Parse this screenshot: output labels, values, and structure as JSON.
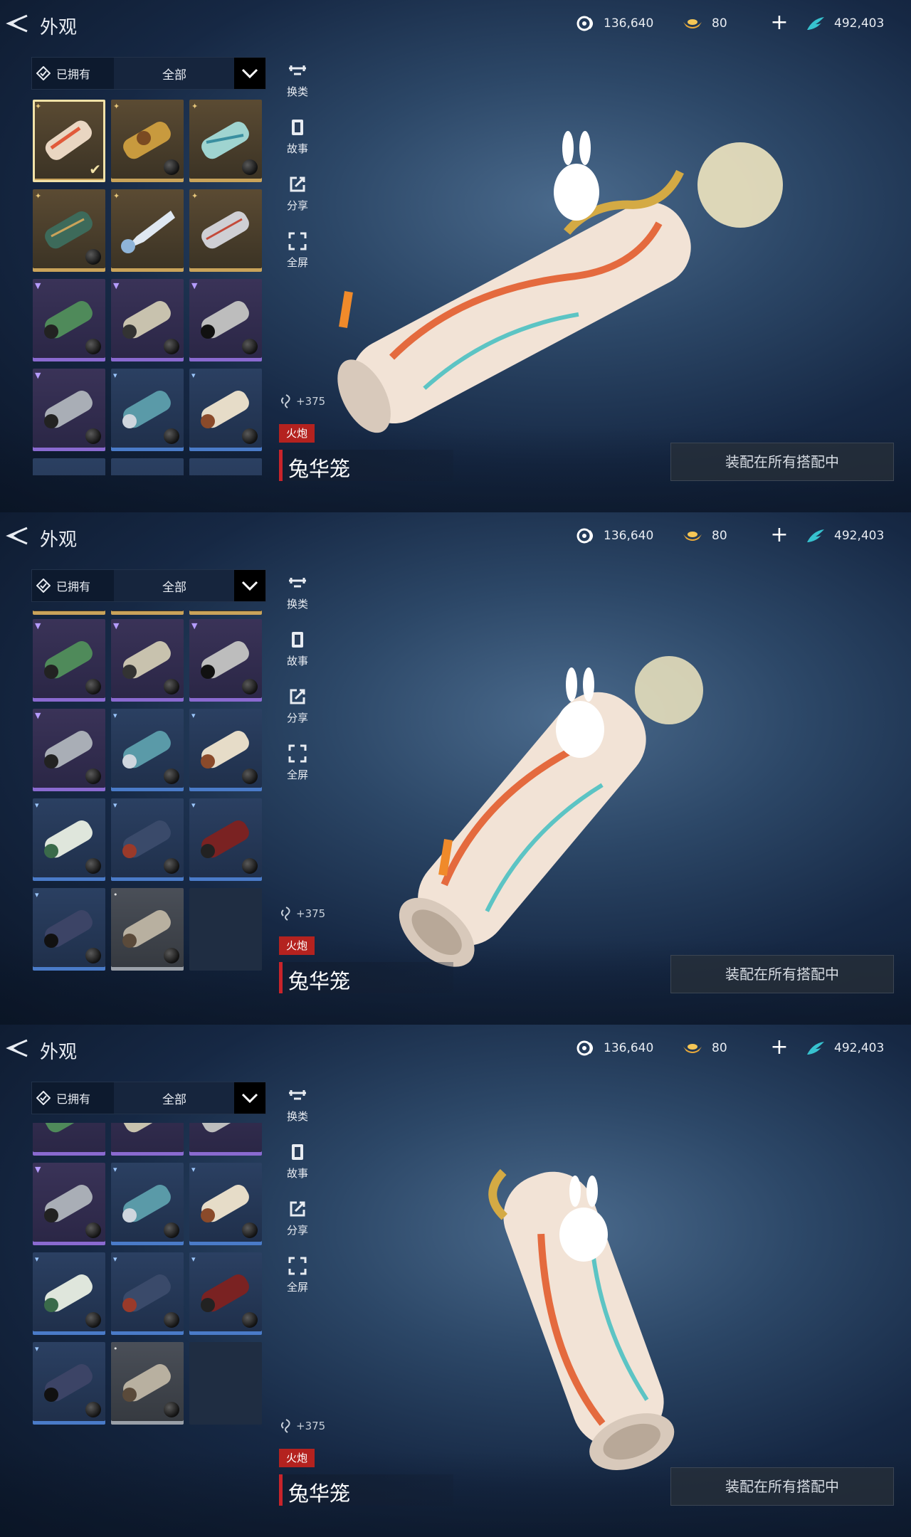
{
  "header": {
    "title": "外观"
  },
  "currencies": [
    {
      "icon": "wheel-icon",
      "value": "136,640"
    },
    {
      "icon": "gold-ingot-icon",
      "value": "80"
    },
    {
      "icon": "feather-icon",
      "value": "492,403"
    }
  ],
  "filter": {
    "owned_label": "已拥有",
    "category_value": "全部"
  },
  "side_actions": [
    {
      "icon": "swap-type-icon",
      "label": "换类"
    },
    {
      "icon": "story-book-icon",
      "label": "故事"
    },
    {
      "icon": "share-icon",
      "label": "分享"
    },
    {
      "icon": "fullscreen-icon",
      "label": "全屏"
    }
  ],
  "item": {
    "power": "+375",
    "type_badge": "火炮",
    "name": "兔华笼",
    "equip_button": "装配在所有搭配中"
  },
  "colors": {
    "accent_red": "#b4221f",
    "gold_rarity": "#c9a35a",
    "purple_rarity": "#8a6ad0",
    "blue_rarity": "#4a7bc8",
    "gray_rarity": "#9aa0a8"
  }
}
